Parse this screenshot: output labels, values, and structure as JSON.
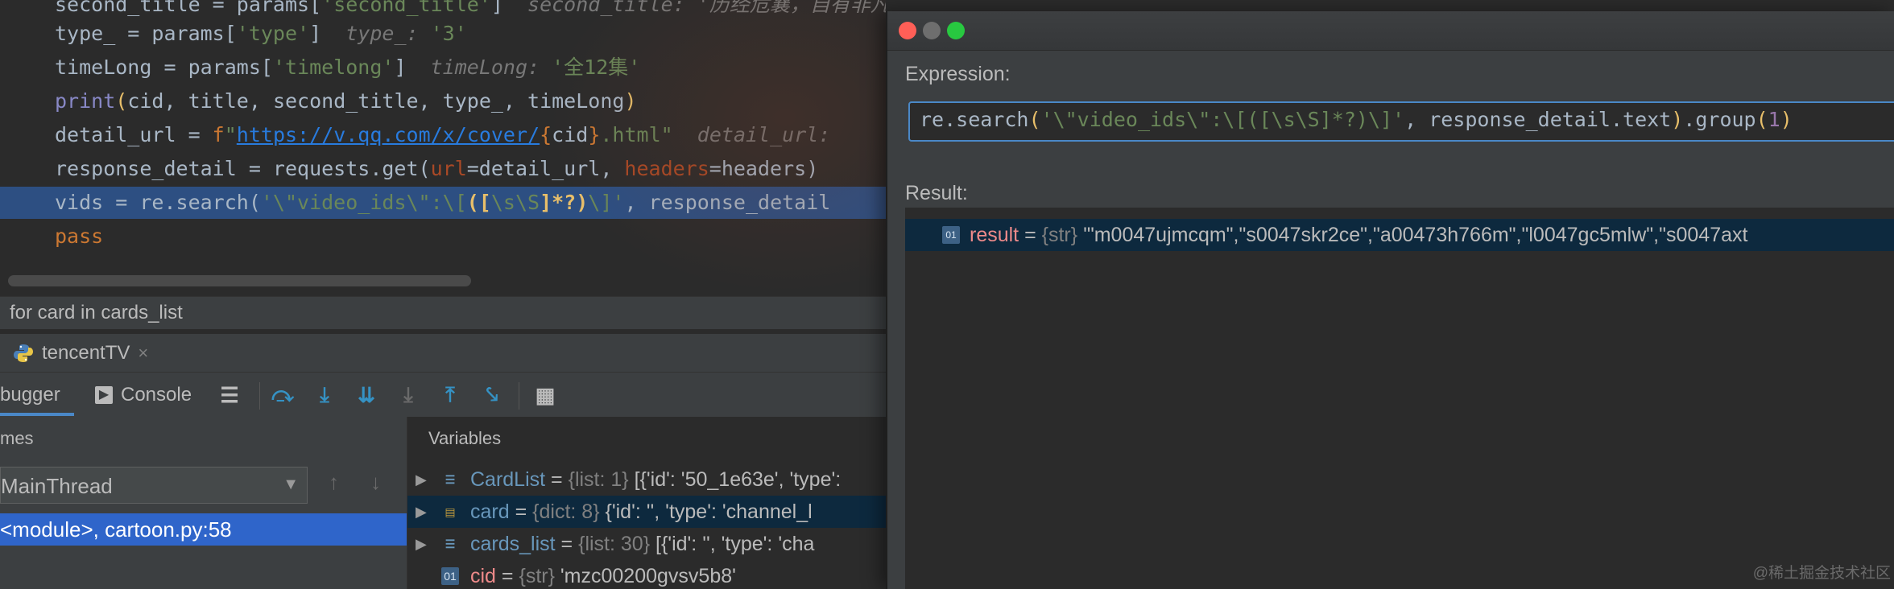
{
  "editor": {
    "lines": [
      {
        "parts": [
          [
            "k-white",
            "second_title = params["
          ],
          [
            "k-str",
            "'second_title'"
          ],
          [
            "k-white",
            "]  "
          ],
          [
            "k-hint",
            "second_title: '历经危襄，自有非凡故事"
          ]
        ]
      },
      {
        "parts": [
          [
            "k-white",
            "type_ = params["
          ],
          [
            "k-str",
            "'type'"
          ],
          [
            "k-white",
            "]  "
          ],
          [
            "k-hint",
            "type_: "
          ],
          [
            "k-str",
            "'3'"
          ]
        ]
      },
      {
        "parts": [
          [
            "k-white",
            "timeLong = params["
          ],
          [
            "k-str",
            "'timelong'"
          ],
          [
            "k-white",
            "]  "
          ],
          [
            "k-hint",
            "timeLong: "
          ],
          [
            "k-str",
            "'全12集'"
          ]
        ]
      },
      {
        "parts": [
          [
            "k-builtin",
            "print"
          ],
          [
            "k-yellow",
            "("
          ],
          [
            "k-white",
            "cid, title, second_title, type_, timeLong"
          ],
          [
            "k-yellow",
            ")"
          ]
        ]
      },
      {
        "parts": [
          [
            "k-white",
            "detail_url = "
          ],
          [
            "k-orange",
            "f"
          ],
          [
            "k-str",
            "\""
          ],
          [
            "k-url",
            "https://v.qq.com/x/cover/"
          ],
          [
            "k-orange",
            "{"
          ],
          [
            "k-white",
            "cid"
          ],
          [
            "k-orange",
            "}"
          ],
          [
            "k-str",
            ".html\""
          ],
          [
            "k-white",
            "  "
          ],
          [
            "k-hint",
            "detail_url: "
          ]
        ]
      },
      {
        "parts": [
          [
            "k-white",
            "response_detail = requests.get("
          ],
          [
            "k-param",
            "url"
          ],
          [
            "k-white",
            "=detail_url, "
          ],
          [
            "k-param",
            "headers"
          ],
          [
            "k-white",
            "=headers)"
          ]
        ]
      },
      {
        "parts": [
          [
            "k-white",
            "vids = re.search("
          ],
          [
            "k-str",
            "'\\\"video_ids\\\":\\["
          ],
          [
            "k-bold",
            "(["
          ],
          [
            "k-str",
            "\\s\\S"
          ],
          [
            "k-bold",
            "]*?)"
          ],
          [
            "k-str",
            "\\]'"
          ],
          [
            "k-white",
            ", response_detail"
          ]
        ]
      },
      {
        "parts": [
          [
            "k-orange",
            "pass"
          ]
        ]
      }
    ]
  },
  "breadcrumb": "for card in cards_list",
  "run_tab": {
    "label": "tencentTV",
    "close": "×",
    "icon": "python-icon"
  },
  "toolbar": {
    "debugger_label": "bugger",
    "console_label": "Console"
  },
  "frames": {
    "title": "mes",
    "thread": "MainThread",
    "frame": "<module>, cartoon.py:58"
  },
  "variables": {
    "title": "Variables",
    "rows": [
      {
        "name": "CardList",
        "type": "{list: 1}",
        "value": "[{'id': '50_1e63e', 'type':",
        "icon": "list-icon",
        "selected": false,
        "expandable": true
      },
      {
        "name": "card",
        "type": "{dict: 8}",
        "value": "{'id': '', 'type': 'channel_l",
        "icon": "dict-icon",
        "selected": true,
        "expandable": true
      },
      {
        "name": "cards_list",
        "type": "{list: 30}",
        "value": "[{'id': '', 'type': 'cha",
        "icon": "list-icon",
        "selected": false,
        "expandable": true
      },
      {
        "name": "cid",
        "type": "{str}",
        "value": "'mzc00200gvsv5b8'",
        "icon": "str-icon",
        "selected": false,
        "expandable": false
      }
    ]
  },
  "dialog": {
    "expression_label": "Expression:",
    "expression_parts": [
      [
        "k-white",
        "re.search"
      ],
      [
        "k-yellow",
        "("
      ],
      [
        "k-str",
        "'\\\"video_ids\\\":\\[(["
      ],
      [
        "k-str",
        "\\s\\S"
      ],
      [
        "k-str",
        "]*?)\\]'"
      ],
      [
        "k-white",
        ", response_detail.text"
      ],
      [
        "k-yellow",
        ")"
      ],
      [
        "k-white",
        ".group"
      ],
      [
        "k-yellow",
        "("
      ],
      [
        "k-purple",
        "1"
      ],
      [
        "k-yellow",
        ")"
      ]
    ],
    "result_label": "Result:",
    "result_name": "result",
    "result_type": "{str}",
    "result_value": "'\"m0047ujmcqm\",\"s0047skr2ce\",\"a00473h766m\",\"l0047gc5mlw\",\"s0047axt",
    "watermark": "@稀土掘金技术社区"
  },
  "colors": {
    "accent": "#4a88c7",
    "selection": "#2f65ca",
    "close": "#ff5f57",
    "minimize": "#6e6e6e",
    "zoom": "#28c840"
  }
}
